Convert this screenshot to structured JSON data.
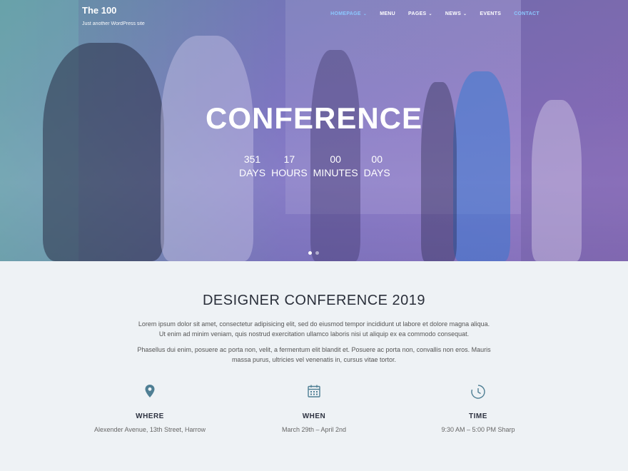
{
  "site": {
    "title": "The 100",
    "tagline": "Just another WordPress site"
  },
  "nav": {
    "items": [
      {
        "label": "HOMEPAGE",
        "active": true,
        "has_dropdown": true
      },
      {
        "label": "MENU",
        "active": false,
        "has_dropdown": false
      },
      {
        "label": "PAGES",
        "active": false,
        "has_dropdown": true
      },
      {
        "label": "NEWS",
        "active": false,
        "has_dropdown": true
      },
      {
        "label": "EVENTS",
        "active": false,
        "has_dropdown": false
      },
      {
        "label": "CONTACT",
        "active": true,
        "has_dropdown": false
      }
    ],
    "dropdown_icon": "chevron-down-icon"
  },
  "hero": {
    "title": "CONFERENCE",
    "countdown": [
      {
        "value": "351",
        "label": "DAYS"
      },
      {
        "value": "17",
        "label": "HOURS"
      },
      {
        "value": "00",
        "label": "MINUTES"
      },
      {
        "value": "00",
        "label": "DAYS"
      }
    ],
    "slides": 2,
    "active_slide": 1
  },
  "section": {
    "title": "DESIGNER CONFERENCE 2019",
    "paragraph1": "Lorem ipsum dolor sit amet, consectetur adipisicing elit, sed do eiusmod tempor incididunt ut labore et dolore magna aliqua. Ut enim ad minim veniam, quis nostrud exercitation ullamco laboris nisi ut aliquip ex ea commodo consequat.",
    "paragraph2": "Phasellus dui enim, posuere ac porta non, velit, a fermentum elit blandit et. Posuere ac porta non, convallis non eros. Mauris massa purus, ultricies vel venenatis in, cursus vitae tortor."
  },
  "features": [
    {
      "icon": "map-pin-icon",
      "heading": "WHERE",
      "value": "Alexender Avenue, 13th Street, Harrow"
    },
    {
      "icon": "calendar-icon",
      "heading": "WHEN",
      "value": "March 29th – April 2nd"
    },
    {
      "icon": "clock-icon",
      "heading": "TIME",
      "value": "9:30 AM – 5:00 PM Sharp"
    }
  ],
  "colors": {
    "accent": "#8cc8ff",
    "icon_teal": "#4f7f94",
    "heading": "#2a2f3a",
    "section_bg": "#eef2f5"
  }
}
